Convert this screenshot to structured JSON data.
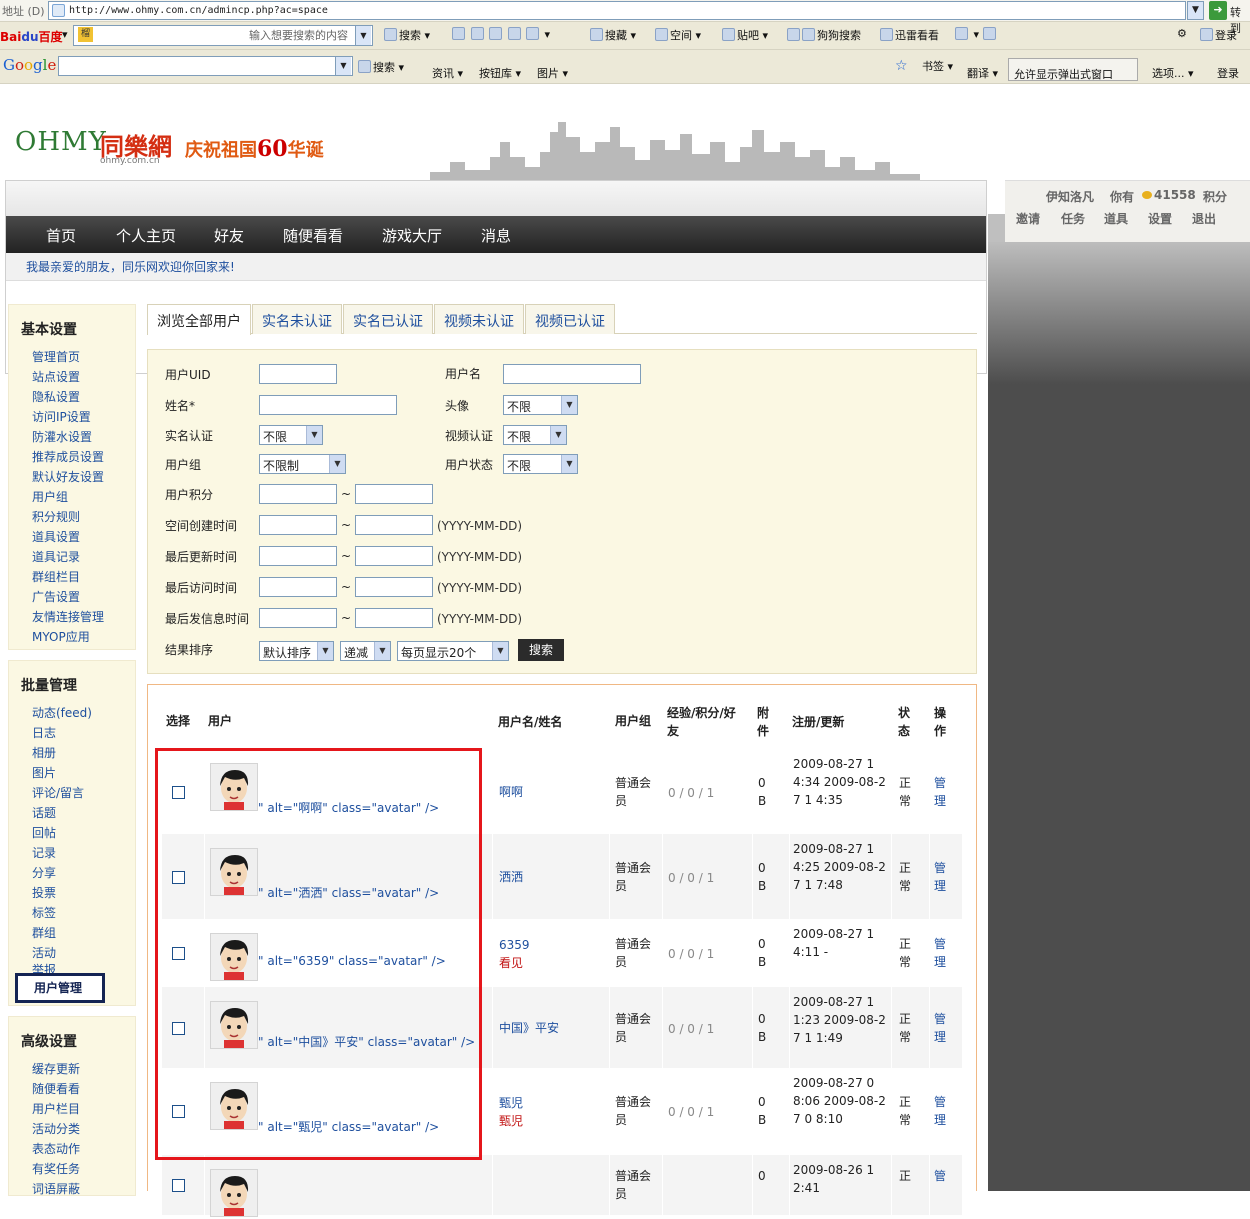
{
  "browser": {
    "address_label": "地址 (D)",
    "url": "http://www.ohmy.com.cn/admincp.php?ac=space",
    "go_label": "转到",
    "baidu_placeholder": "输入想要搜索的内容",
    "baidu_box_icon": "榴",
    "baidu_toolbar": [
      "搜索",
      "搜藏",
      "空间",
      "贴吧",
      "狗狗搜索",
      "迅雷看看",
      "登录"
    ],
    "google_toolbar": [
      "搜索",
      "资讯",
      "按钮库",
      "图片",
      "书签",
      "翻译",
      "允许显示弹出式窗口",
      "选项...",
      "登录"
    ]
  },
  "site": {
    "logo_en": "OHMY",
    "logo_cn": "同樂網",
    "logo_url": "ohmy.com.cn",
    "slogan_a": "庆祝祖国",
    "slogan_num": "60",
    "slogan_b": "华诞",
    "nav": [
      "首页",
      "个人主页",
      "好友",
      "随便看看",
      "游戏大厅",
      "消息"
    ],
    "welcome": "我最亲爱的朋友，同乐网欢迎你回家来!",
    "user": {
      "name": "伊知洛凡",
      "you_have": "你有",
      "points": "41558",
      "points_label": "积分"
    },
    "user_links": [
      "邀请",
      "任务",
      "道具",
      "设置",
      "退出"
    ]
  },
  "sidebar": {
    "basic_title": "基本设置",
    "basic": [
      "管理首页",
      "站点设置",
      "隐私设置",
      "访问IP设置",
      "防灌水设置",
      "推荐成员设置",
      "默认好友设置",
      "用户组",
      "积分规则",
      "道具设置",
      "道具记录",
      "群组栏目",
      "广告设置",
      "友情连接管理",
      "MYOP应用"
    ],
    "batch_title": "批量管理",
    "batch": [
      "动态(feed)",
      "日志",
      "相册",
      "图片",
      "评论/留言",
      "话题",
      "回帖",
      "记录",
      "分享",
      "投票",
      "标签",
      "群组",
      "活动",
      "举报"
    ],
    "batch_active": "用户管理",
    "advanced_title": "高级设置",
    "advanced": [
      "缓存更新",
      "随便看看",
      "用户栏目",
      "活动分类",
      "表态动作",
      "有奖任务",
      "词语屏蔽"
    ]
  },
  "tabs": [
    "浏览全部用户",
    "实名未认证",
    "实名已认证",
    "视频未认证",
    "视频已认证"
  ],
  "form": {
    "uid": "用户UID",
    "username": "用户名",
    "realname": "姓名*",
    "avatar": "头像",
    "avatar_value": "不限",
    "name_verify": "实名认证",
    "name_verify_value": "不限",
    "video_verify": "视频认证",
    "video_verify_value": "不限",
    "group": "用户组",
    "group_value": "不限制",
    "status": "用户状态",
    "status_value": "不限",
    "credit": "用户积分",
    "created": "空间创建时间",
    "updated": "最后更新时间",
    "visited": "最后访问时间",
    "posted": "最后发信息时间",
    "date_hint": "(YYYY-MM-DD)",
    "tilde": "~",
    "sort": "结果排序",
    "sort_value": "默认排序",
    "order_value": "递减",
    "perpage_value": "每页显示20个",
    "search_button": "搜索"
  },
  "table": {
    "headers": {
      "select": "选择",
      "user": "用户",
      "name": "用户名/姓名",
      "group": "用户组",
      "exp": "经验/积分/好友",
      "attach": "附件",
      "reg": "注册/更新",
      "state": "状态",
      "op": "操作"
    },
    "rows": [
      {
        "alt": "\" alt=\"啊啊\" class=\"avatar\" />",
        "name": "啊啊",
        "real": "",
        "group": "普通会员",
        "stats": "0 / 0 / 1",
        "attach": "0 B",
        "reg": "2009-08-27 1 4:34 2009-08-27 1 4:35",
        "state": "正常",
        "op": "管理"
      },
      {
        "alt": "\" alt=\"洒洒\" class=\"avatar\" />",
        "name": "洒洒",
        "real": "",
        "group": "普通会员",
        "stats": "0 / 0 / 1",
        "attach": "0 B",
        "reg": "2009-08-27 1 4:25 2009-08-27 1 7:48",
        "state": "正常",
        "op": "管理"
      },
      {
        "alt": "\" alt=\"6359\" class=\"avatar\" />",
        "name": "6359",
        "real": "看见",
        "group": "普通会员",
        "stats": "0 / 0 / 1",
        "attach": "0 B",
        "reg": "2009-08-27 1 4:11 -",
        "state": "正常",
        "op": "管理"
      },
      {
        "alt": "\" alt=\"中国》平安\" class=\"avatar\" />",
        "name": "中国》平安",
        "real": "",
        "group": "普通会员",
        "stats": "0 / 0 / 1",
        "attach": "0 B",
        "reg": "2009-08-27 1 1:23 2009-08-27 1 1:49",
        "state": "正常",
        "op": "管理"
      },
      {
        "alt": "\" alt=\"甄児\" class=\"avatar\" />",
        "name": "甄児",
        "real": "甄児",
        "group": "普通会员",
        "stats": "0 / 0 / 1",
        "attach": "0 B",
        "reg": "2009-08-27 0 8:06 2009-08-27 0 8:10",
        "state": "正常",
        "op": "管理"
      },
      {
        "alt": "",
        "name": "",
        "real": "",
        "group": "普通会员",
        "stats": "",
        "attach": "0",
        "reg": "2009-08-26 1 2:41",
        "state": "正",
        "op": "管"
      }
    ]
  },
  "colors": {
    "accent_red": "#e5161b",
    "link_blue": "#1e4f9e",
    "nav_dark": "#2b2b2b",
    "form_bg": "#fbf8e3"
  }
}
